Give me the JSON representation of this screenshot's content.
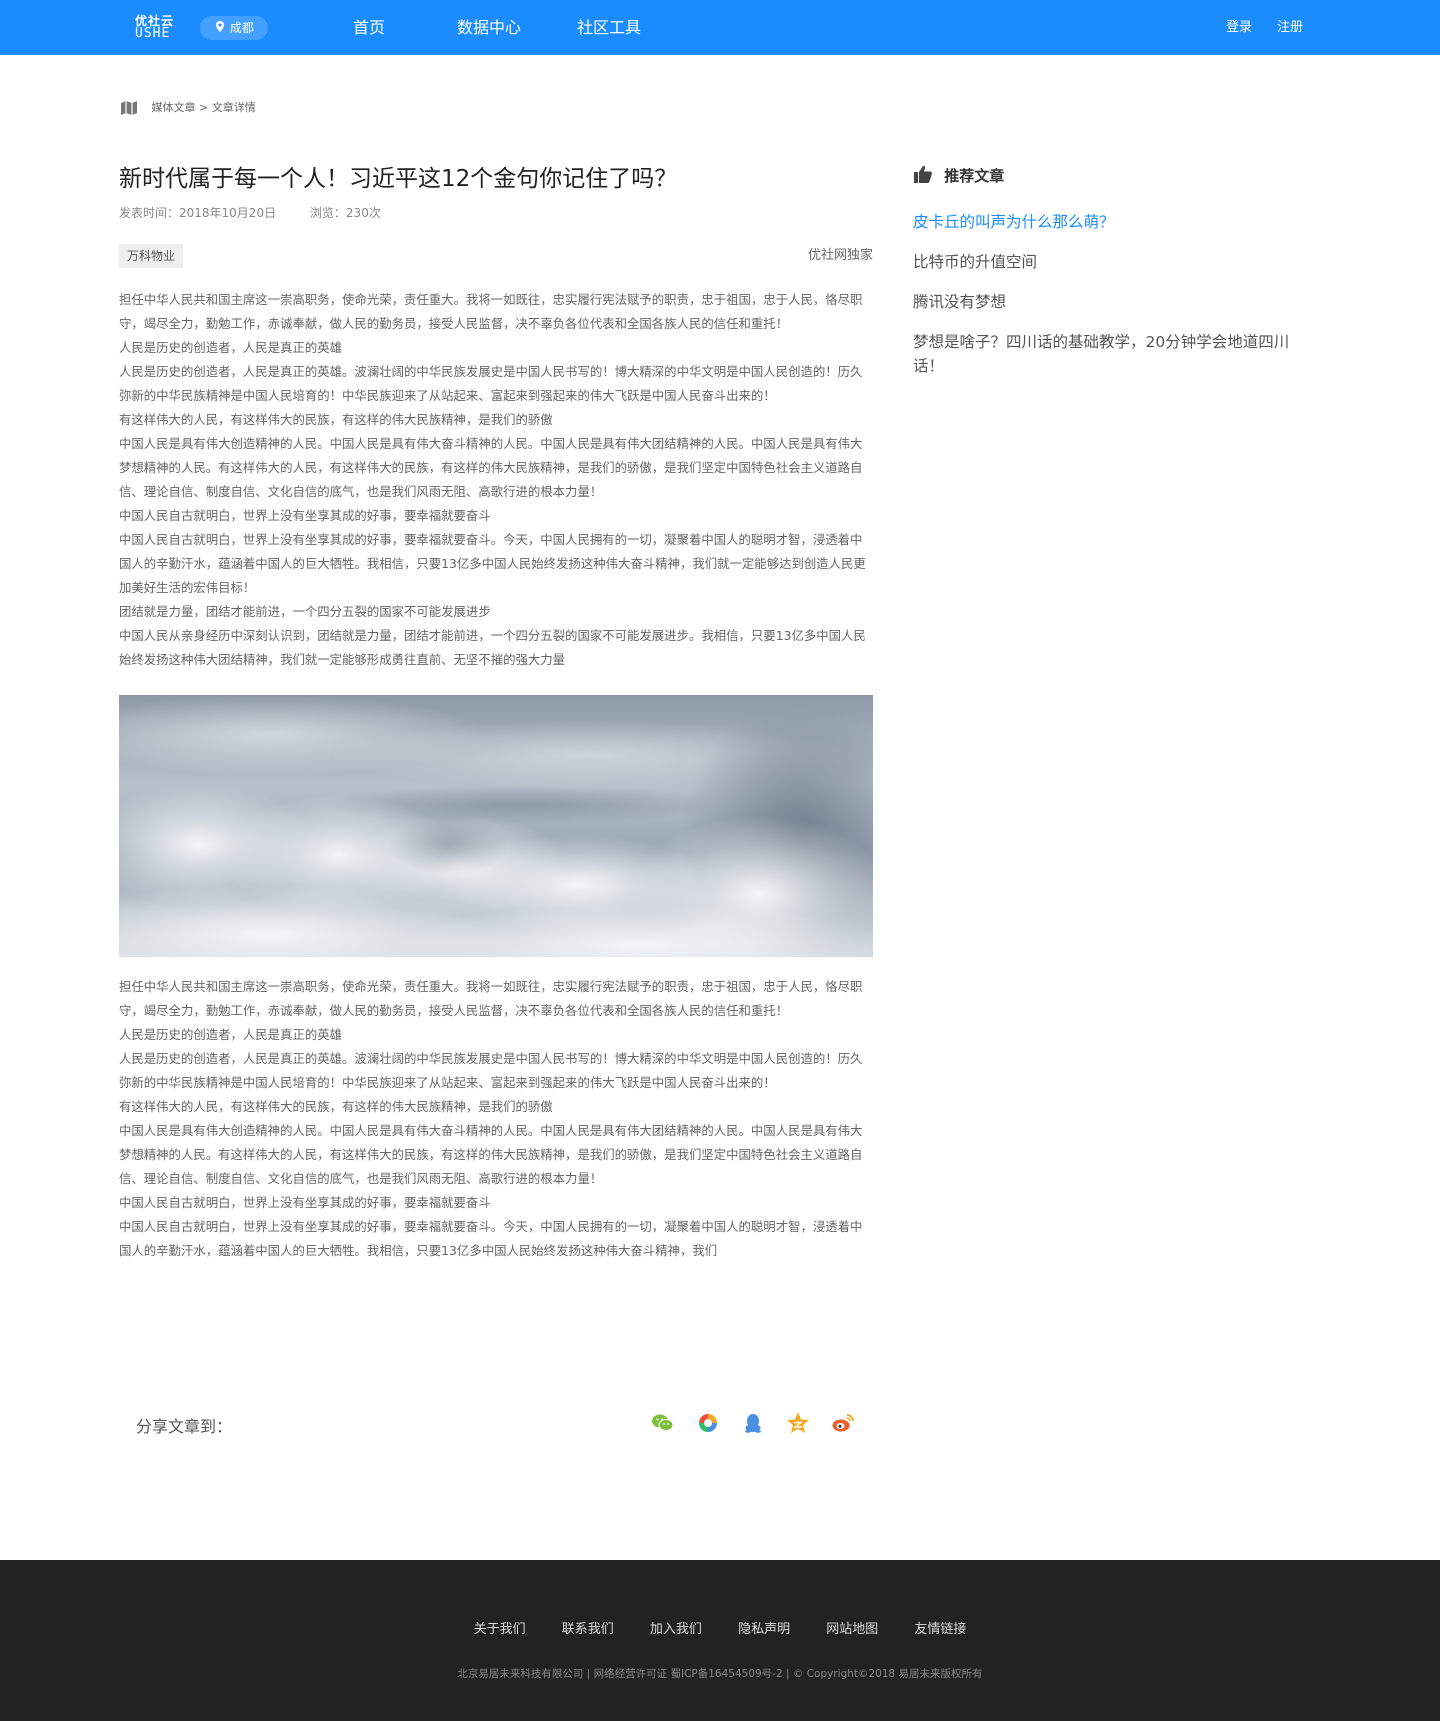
{
  "header": {
    "logo_line1": "优社云",
    "logo_line2": "USHE",
    "city": "成都",
    "nav": [
      "首页",
      "数据中心",
      "社区工具"
    ],
    "login": "登录",
    "register": "注册",
    "brand_color": "#1a8cff"
  },
  "breadcrumb": "媒体文章 > 文章详情",
  "article": {
    "title": "新时代属于每一个人！习近平这12个金句你记住了吗？",
    "publish_time": "发表时间：2018年10月20日",
    "views": "浏览：230次",
    "tag": "万科物业",
    "exclusive": "优社网独家",
    "paragraphs": [
      "担任中华人民共和国主席这一崇高职务，使命光荣，责任重大。我将一如既往，忠实履行宪法赋予的职责，忠于祖国，忠于人民，恪尽职守，竭尽全力，勤勉工作，赤诚奉献，做人民的勤务员，接受人民监督，决不辜负各位代表和全国各族人民的信任和重托！",
      "人民是历史的创造者，人民是真正的英雄",
      "人民是历史的创造者，人民是真正的英雄。波澜壮阔的中华民族发展史是中国人民书写的！博大精深的中华文明是中国人民创造的！历久弥新的中华民族精神是中国人民培育的！中华民族迎来了从站起来、富起来到强起来的伟大飞跃是中国人民奋斗出来的！",
      "有这样伟大的人民，有这样伟大的民族，有这样的伟大民族精神，是我们的骄傲",
      "中国人民是具有伟大创造精神的人民。中国人民是具有伟大奋斗精神的人民。中国人民是具有伟大团结精神的人民。中国人民是具有伟大梦想精神的人民。有这样伟大的人民，有这样伟大的民族，有这样的伟大民族精神，是我们的骄傲，是我们坚定中国特色社会主义道路自信、理论自信、制度自信、文化自信的底气，也是我们风雨无阻、高歌行进的根本力量！",
      "中国人民自古就明白，世界上没有坐享其成的好事，要幸福就要奋斗",
      "中国人民自古就明白，世界上没有坐享其成的好事，要幸福就要奋斗。今天，中国人民拥有的一切，凝聚着中国人的聪明才智，浸透着中国人的辛勤汗水，蕴涵着中国人的巨大牺牲。我相信，只要13亿多中国人民始终发扬这种伟大奋斗精神，我们就一定能够达到创造人民更加美好生活的宏伟目标！",
      "团结就是力量，团结才能前进，一个四分五裂的国家不可能发展进步",
      "中国人民从亲身经历中深刻认识到，团结就是力量，团结才能前进，一个四分五裂的国家不可能发展进步。我相信，只要13亿多中国人民始终发扬这种伟大团结精神，我们就一定能够形成勇往直前、无坚不摧的强大力量"
    ],
    "paragraphs2": [
      "担任中华人民共和国主席这一崇高职务，使命光荣，责任重大。我将一如既往，忠实履行宪法赋予的职责，忠于祖国，忠于人民，恪尽职守，竭尽全力，勤勉工作，赤诚奉献，做人民的勤务员，接受人民监督，决不辜负各位代表和全国各族人民的信任和重托！",
      "人民是历史的创造者，人民是真正的英雄",
      "人民是历史的创造者，人民是真正的英雄。波澜壮阔的中华民族发展史是中国人民书写的！博大精深的中华文明是中国人民创造的！历久弥新的中华民族精神是中国人民培育的！中华民族迎来了从站起来、富起来到强起来的伟大飞跃是中国人民奋斗出来的！",
      "有这样伟大的人民，有这样伟大的民族，有这样的伟大民族精神，是我们的骄傲",
      "中国人民是具有伟大创造精神的人民。中国人民是具有伟大奋斗精神的人民。中国人民是具有伟大团结精神的人民。中国人民是具有伟大梦想精神的人民。有这样伟大的人民，有这样伟大的民族，有这样的伟大民族精神，是我们的骄傲，是我们坚定中国特色社会主义道路自信、理论自信、制度自信、文化自信的底气，也是我们风雨无阻、高歌行进的根本力量！",
      "中国人民自古就明白，世界上没有坐享其成的好事，要幸福就要奋斗",
      "中国人民自古就明白，世界上没有坐享其成的好事，要幸福就要奋斗。今天，中国人民拥有的一切，凝聚着中国人的聪明才智，浸透着中国人的辛勤汗水，蕴涵着中国人的巨大牺牲。我相信，只要13亿多中国人民始终发扬这种伟大奋斗精神，我们"
    ]
  },
  "share": {
    "label": "分享文章到：",
    "icons": [
      "wechat-icon",
      "moments-icon",
      "qq-icon",
      "qzone-icon",
      "weibo-icon"
    ]
  },
  "sidebar": {
    "title": "推荐文章",
    "items": [
      "皮卡丘的叫声为什么那么萌？",
      "比特币的升值空间",
      "腾讯没有梦想",
      "梦想是啥子？四川话的基础教学，20分钟学会地道四川话！"
    ]
  },
  "footer": {
    "links": [
      "关于我们",
      "联系我们",
      "加入我们",
      "隐私声明",
      "网站地图",
      "友情链接"
    ],
    "copyright": "北京易居未来科技有限公司 | 网络经营许可证 蜀ICP备16454509号-2 | © Copyright©2018 易居未来版权所有"
  }
}
